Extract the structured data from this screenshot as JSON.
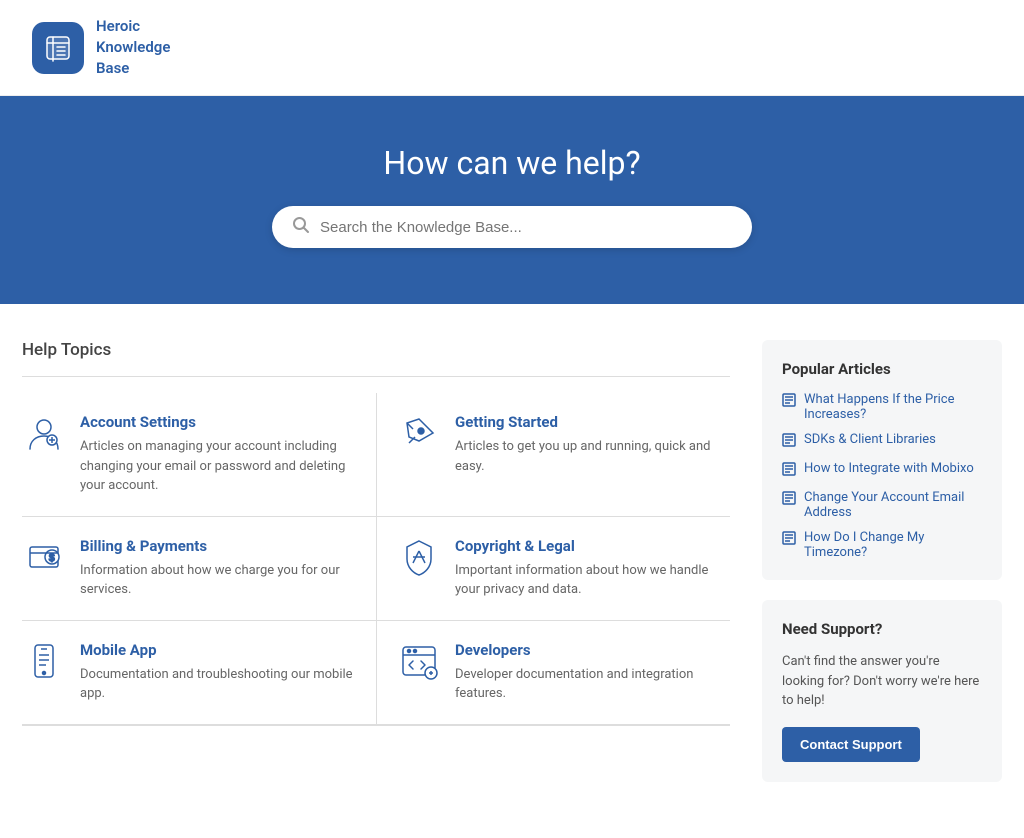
{
  "header": {
    "logo_text": "Heroic Knowledge Base",
    "logo_text_line1": "Heroic",
    "logo_text_line2": "Knowledge",
    "logo_text_line3": "Base"
  },
  "hero": {
    "title": "How can we help?",
    "search_placeholder": "Search the Knowledge Base..."
  },
  "main": {
    "section_title": "Help Topics",
    "topics": [
      {
        "id": "account-settings",
        "icon": "person",
        "title": "Account Settings",
        "description": "Articles on managing your account including changing your email or password and deleting your account."
      },
      {
        "id": "getting-started",
        "icon": "rocket",
        "title": "Getting Started",
        "description": "Articles to get you up and running, quick and easy."
      },
      {
        "id": "billing-payments",
        "icon": "billing",
        "title": "Billing & Payments",
        "description": "Information about how we charge you for our services."
      },
      {
        "id": "copyright-legal",
        "icon": "legal",
        "title": "Copyright & Legal",
        "description": "Important information about how we handle your privacy and data."
      },
      {
        "id": "mobile-app",
        "icon": "mobile",
        "title": "Mobile App",
        "description": "Documentation and troubleshooting our mobile app."
      },
      {
        "id": "developers",
        "icon": "developers",
        "title": "Developers",
        "description": "Developer documentation and integration features."
      }
    ]
  },
  "sidebar": {
    "popular_articles": {
      "title": "Popular Articles",
      "articles": [
        "What Happens If the Price Increases?",
        "SDKs & Client Libraries",
        "How to Integrate with Mobixo",
        "Change Your Account Email Address",
        "How Do I Change My Timezone?"
      ]
    },
    "support": {
      "title": "Need Support?",
      "description": "Can't find the answer you're looking for? Don't worry we're here to help!",
      "button_label": "Contact Support"
    }
  }
}
